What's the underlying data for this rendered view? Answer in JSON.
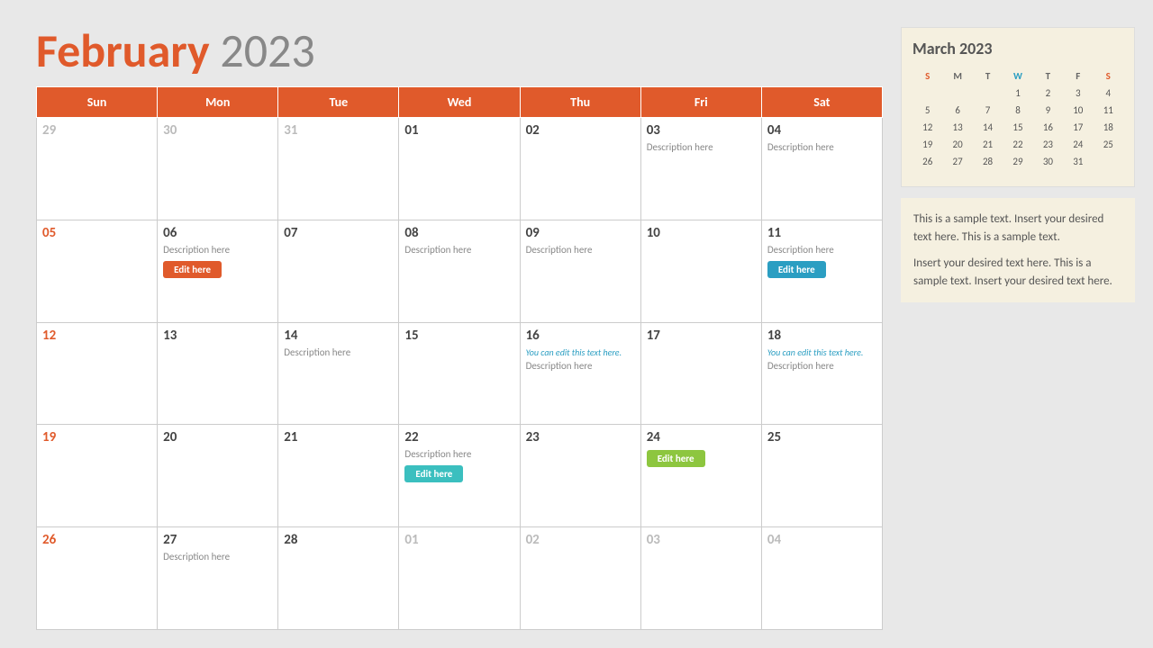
{
  "main": {
    "title_month": "February",
    "title_year": "2023"
  },
  "calendar_headers": [
    "Sun",
    "Mon",
    "Tue",
    "Wed",
    "Thu",
    "Fri",
    "Sat"
  ],
  "calendar_rows": [
    [
      {
        "num": "29",
        "type": "faded"
      },
      {
        "num": "30",
        "type": "faded"
      },
      {
        "num": "31",
        "type": "faded"
      },
      {
        "num": "01",
        "type": "current"
      },
      {
        "num": "02",
        "type": "current"
      },
      {
        "num": "03",
        "type": "current",
        "desc": "Description here"
      },
      {
        "num": "04",
        "type": "current",
        "desc": "Description here"
      }
    ],
    [
      {
        "num": "05",
        "type": "sunday"
      },
      {
        "num": "06",
        "type": "current",
        "desc": "Description here",
        "btn": "Edit here",
        "btn_color": "orange"
      },
      {
        "num": "07",
        "type": "current"
      },
      {
        "num": "08",
        "type": "current",
        "desc": "Description here"
      },
      {
        "num": "09",
        "type": "current",
        "desc": "Description here"
      },
      {
        "num": "10",
        "type": "current"
      },
      {
        "num": "11",
        "type": "current",
        "desc": "Description here",
        "btn": "Edit here",
        "btn_color": "blue"
      }
    ],
    [
      {
        "num": "12",
        "type": "sunday"
      },
      {
        "num": "13",
        "type": "current"
      },
      {
        "num": "14",
        "type": "current",
        "desc": "Description here"
      },
      {
        "num": "15",
        "type": "current"
      },
      {
        "num": "16",
        "type": "current",
        "you_can_edit": "You can edit this text here.",
        "desc": "Description here"
      },
      {
        "num": "17",
        "type": "current"
      },
      {
        "num": "18",
        "type": "current",
        "you_can_edit": "You can edit this text here.",
        "desc": "Description here"
      }
    ],
    [
      {
        "num": "19",
        "type": "sunday"
      },
      {
        "num": "20",
        "type": "current"
      },
      {
        "num": "21",
        "type": "current"
      },
      {
        "num": "22",
        "type": "current",
        "desc": "Description here",
        "btn": "Edit here",
        "btn_color": "teal"
      },
      {
        "num": "23",
        "type": "current"
      },
      {
        "num": "24",
        "type": "current",
        "btn": "Edit here",
        "btn_color": "green"
      },
      {
        "num": "25",
        "type": "current"
      }
    ],
    [
      {
        "num": "26",
        "type": "sunday"
      },
      {
        "num": "27",
        "type": "current",
        "desc": "Description here"
      },
      {
        "num": "28",
        "type": "current"
      },
      {
        "num": "01",
        "type": "faded"
      },
      {
        "num": "02",
        "type": "faded"
      },
      {
        "num": "03",
        "type": "faded"
      },
      {
        "num": "04",
        "type": "faded"
      }
    ]
  ],
  "sidebar": {
    "mini_cal_title": "March 2023",
    "mini_cal_headers": [
      "S",
      "M",
      "T",
      "W",
      "T",
      "F",
      "S"
    ],
    "mini_cal_rows": [
      [
        "",
        "",
        "",
        "1",
        "2",
        "3",
        "4"
      ],
      [
        "5",
        "6",
        "7",
        "8",
        "9",
        "10",
        "11"
      ],
      [
        "12",
        "13",
        "14",
        "15",
        "16",
        "17",
        "18"
      ],
      [
        "19",
        "20",
        "21",
        "22",
        "23",
        "24",
        "25"
      ],
      [
        "26",
        "27",
        "28",
        "29",
        "30",
        "31",
        ""
      ],
      [
        "",
        "",
        "",
        "",
        "",
        "",
        ""
      ]
    ],
    "text1": "This is a sample text. Insert your desired text here. This is a sample text.",
    "text2": "Insert your desired text here. This is a sample text. Insert your desired text here."
  }
}
